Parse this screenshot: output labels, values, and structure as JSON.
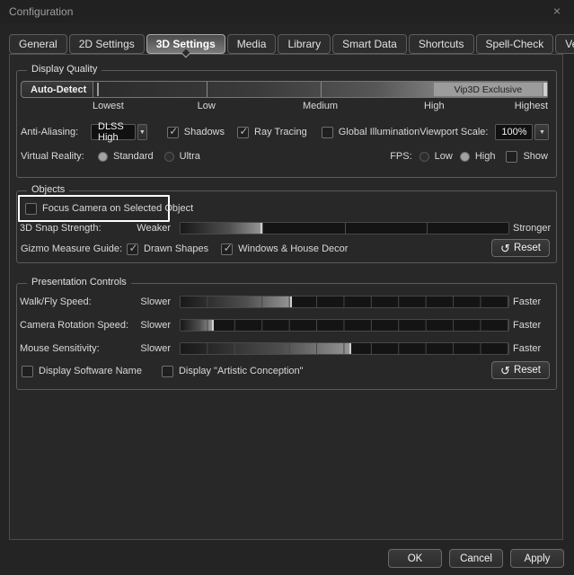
{
  "window": {
    "title": "Configuration"
  },
  "icons": {
    "close": "×",
    "check": "✓",
    "dropdown_arrow": "▼",
    "reset": "↺"
  },
  "tabs": [
    {
      "label": "General",
      "active": false
    },
    {
      "label": "2D Settings",
      "active": false
    },
    {
      "label": "3D Settings",
      "active": true
    },
    {
      "label": "Media",
      "active": false
    },
    {
      "label": "Library",
      "active": false
    },
    {
      "label": "Smart Data",
      "active": false
    },
    {
      "label": "Shortcuts",
      "active": false
    },
    {
      "label": "Spell-Check",
      "active": false
    },
    {
      "label": "Vendors",
      "active": false
    }
  ],
  "display_quality": {
    "legend": "Display Quality",
    "auto_detect_label": "Auto-Detect",
    "exclusive_label": "Vip3D Exclusive",
    "scale_labels": {
      "lowest": "Lowest",
      "low": "Low",
      "medium": "Medium",
      "high": "High",
      "highest": "Highest"
    },
    "anti_aliasing": {
      "label": "Anti-Aliasing:",
      "value": "DLSS High",
      "shadows": {
        "label": "Shadows",
        "checked": true
      },
      "ray_tracing": {
        "label": "Ray Tracing",
        "checked": true
      },
      "global_illumination": {
        "label": "Global Illumination",
        "checked": false
      }
    },
    "viewport_scale": {
      "label": "Viewport Scale:",
      "value": "100%"
    },
    "virtual_reality": {
      "label": "Virtual Reality:",
      "standard": {
        "label": "Standard",
        "selected": true
      },
      "ultra": {
        "label": "Ultra",
        "selected": false
      }
    },
    "fps": {
      "label": "FPS:",
      "low": {
        "label": "Low",
        "selected": false
      },
      "high": {
        "label": "High",
        "selected": true
      },
      "show": {
        "label": "Show",
        "checked": false
      }
    }
  },
  "objects": {
    "legend": "Objects",
    "focus_camera": {
      "label": "Focus Camera on Selected Object",
      "checked": false,
      "highlighted": true
    },
    "snap_strength": {
      "label": "3D Snap Strength:",
      "min": "Weaker",
      "max": "Stronger",
      "fill": "25%"
    },
    "gizmo": {
      "label": "Gizmo Measure Guide:",
      "drawn_shapes": {
        "label": "Drawn Shapes",
        "checked": true
      },
      "windows_decor": {
        "label": "Windows & House Decor",
        "checked": true
      }
    },
    "reset_label": "Reset"
  },
  "presentation": {
    "legend": "Presentation Controls",
    "walk_fly": {
      "label": "Walk/Fly Speed:",
      "min": "Slower",
      "max": "Faster",
      "fill": "34%"
    },
    "camera_rotation": {
      "label": "Camera Rotation Speed:",
      "min": "Slower",
      "max": "Faster",
      "fill": "10%"
    },
    "mouse_sensitivity": {
      "label": "Mouse Sensitivity:",
      "min": "Slower",
      "max": "Faster",
      "fill": "52%"
    },
    "display_software_name": {
      "label": "Display Software Name",
      "checked": false
    },
    "display_artistic": {
      "label": "Display \"Artistic Conception\"",
      "checked": false
    },
    "reset_label": "Reset"
  },
  "footer": {
    "ok": "OK",
    "cancel": "Cancel",
    "apply": "Apply"
  },
  "colors": {
    "highlight_box": "#ffffff",
    "panel_bg": "#282828",
    "exclusive_bg": "#9c9c9c",
    "active_tab_border": "#a8a8a8"
  }
}
